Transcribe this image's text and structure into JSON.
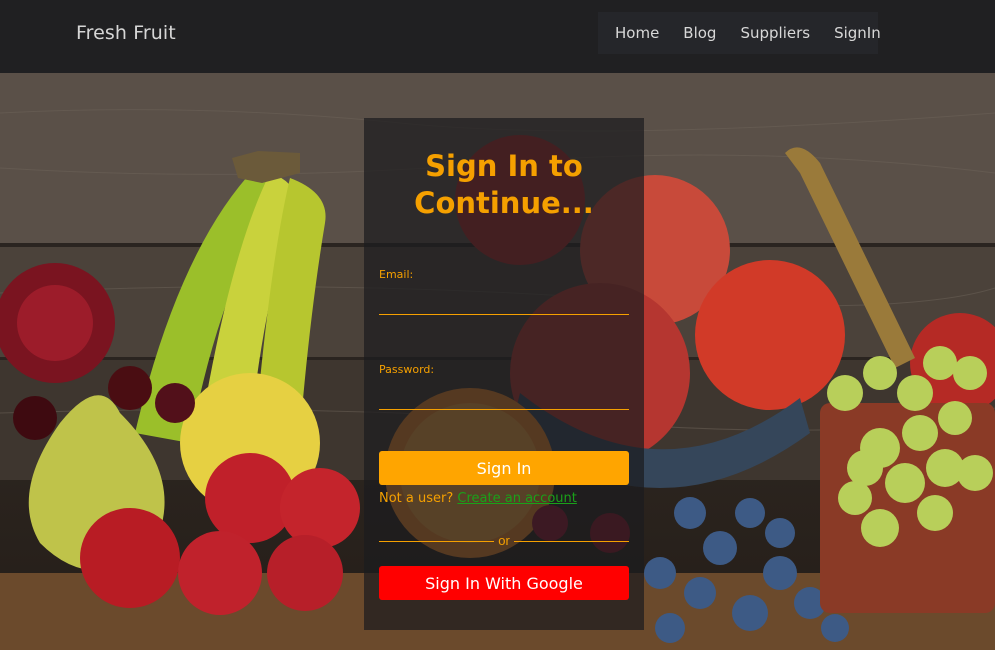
{
  "navbar": {
    "brand": "Fresh Fruit",
    "links": [
      "Home",
      "Blog",
      "Suppliers",
      "SignIn"
    ]
  },
  "login": {
    "title_line1": "Sign In to",
    "title_line2": "Continue...",
    "email_label": "Email:",
    "password_label": "Password:",
    "signin_button": "Sign In",
    "not_user_text": "Not a user?",
    "create_account_link": "Create an account",
    "divider_text": "or",
    "google_button": "Sign In With Google"
  },
  "colors": {
    "accent": "#ffa500",
    "google": "#ff0000",
    "link": "#1aa11a",
    "navbar_bg": "#202022"
  }
}
